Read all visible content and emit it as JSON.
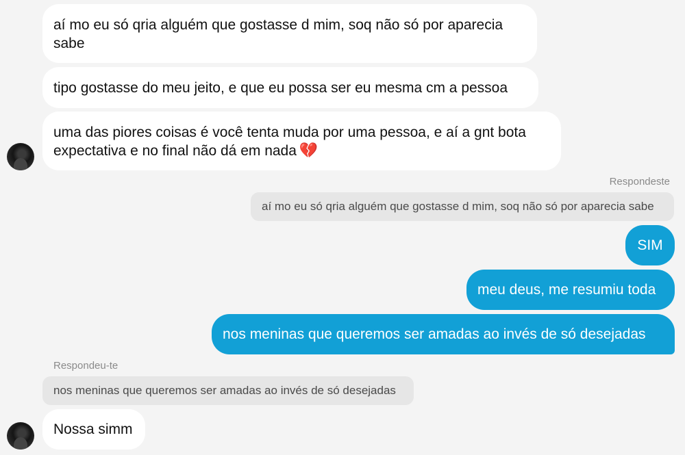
{
  "messages": {
    "m1_line1": "aí mo eu só qria alguém que gostasse d mim, soq não só por aparecia",
    "m1_line2": "sabe",
    "m2": "tipo gostasse do meu jeito, e que eu possa ser eu mesma cm a pessoa",
    "m3_line1": "uma das piores coisas é você tenta muda por uma pessoa, e aí a gnt bota",
    "m3_line2": "expectativa e no final não dá em nada",
    "m3_emoji": "💔",
    "reply_label_out": "Respondeste",
    "reply_quote_out": "aí mo eu só qria alguém que gostasse d mim, soq não só por aparecia sabe",
    "out1": "SIM",
    "out2": "meu deus, me resumiu toda",
    "out3": "nos meninas que queremos ser amadas ao invés de só desejadas",
    "reply_label_in": "Respondeu-te",
    "reply_quote_in": "nos meninas que queremos ser amadas ao invés de só desejadas",
    "in_last": "Nossa simm"
  },
  "colors": {
    "background": "#f4f4f4",
    "incoming_bubble": "#ffffff",
    "outgoing_bubble": "#12a0d6",
    "quote_bubble": "#e6e6e6"
  }
}
